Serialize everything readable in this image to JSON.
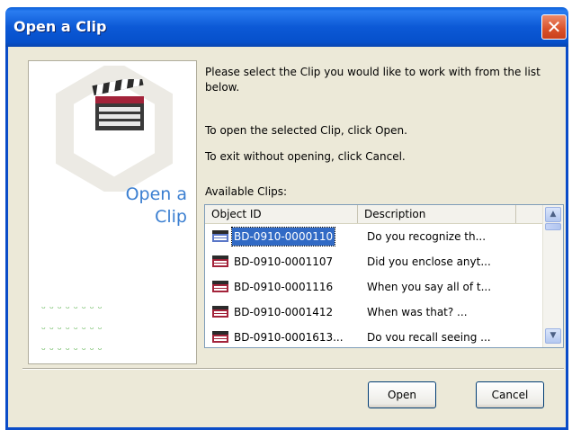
{
  "window": {
    "title": "Open a Clip",
    "close_glyph": "✕"
  },
  "left_panel": {
    "label_line1": "Open a",
    "label_line2": "Clip",
    "icon": "clapperboard-icon"
  },
  "instructions": {
    "intro": "Please select the Clip you would like to work with from the list below.",
    "open_text": "To open the selected Clip, click Open.",
    "cancel_text": "To exit without opening, click Cancel."
  },
  "list": {
    "label": "Available Clips:",
    "columns": [
      "Object ID",
      "Description"
    ],
    "rows": [
      {
        "id": "BD-0910-0000110",
        "description": "Do you recognize th..."
      },
      {
        "id": "BD-0910-0001107",
        "description": "Did you enclose anyt..."
      },
      {
        "id": "BD-0910-0001116",
        "description": "When you say all of t..."
      },
      {
        "id": "BD-0910-0001412",
        "description": "When was that? ..."
      },
      {
        "id": "BD-0910-0001613...",
        "description": "Do vou recall seeing ..."
      }
    ],
    "selected_index": 0
  },
  "buttons": {
    "open": "Open",
    "cancel": "Cancel"
  },
  "colors": {
    "titlebar": "#0a5fd8",
    "selection": "#316ac5",
    "accent_label": "#3b7fd1"
  }
}
